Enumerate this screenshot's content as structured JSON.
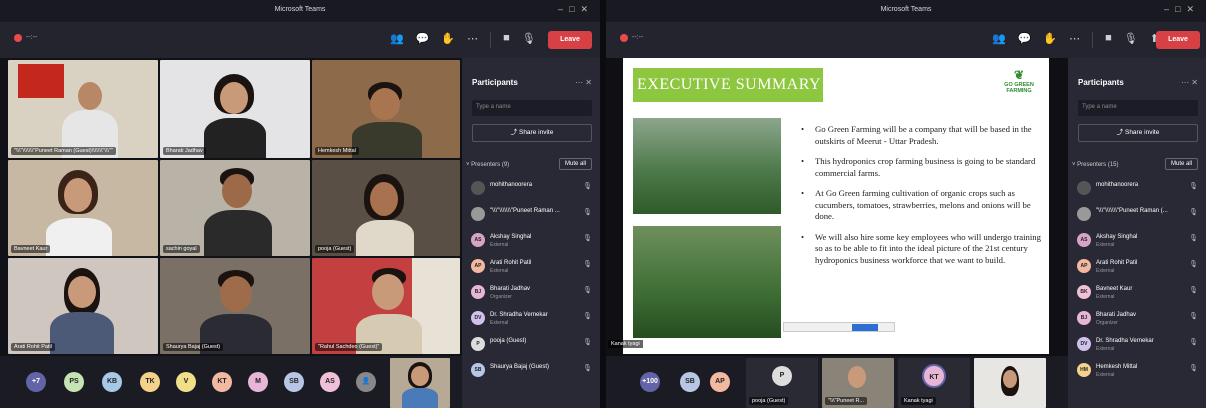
{
  "left": {
    "window_title": "Microsoft Teams",
    "rec_time": "--:--",
    "leave_label": "Leave",
    "tiles": [
      {
        "name": "\"\\\\\\\"\\\\\\\\\\\\\\\"Puneet Raman (Guest)\\\\\\\\\\\\\\\"\\\\\\\"\""
      },
      {
        "name": "Bharati Jadhav"
      },
      {
        "name": "Hemkesh Mittal"
      },
      {
        "name": "Bavneet Kaur"
      },
      {
        "name": "sachin goyal"
      },
      {
        "name": "pooja (Guest)"
      },
      {
        "name": "Arati Rohit Patil"
      },
      {
        "name": "Shaurya Bajaj (Guest)"
      },
      {
        "name": "\"Rahul Sachdeo (Guest)\""
      }
    ],
    "strip_avatars": [
      "+7",
      "PS",
      "KB",
      "TK",
      "V",
      "KT",
      "M",
      "SB",
      "AS"
    ],
    "panel": {
      "title": "Participants",
      "search_placeholder": "Type a name",
      "share_label": "Share invite",
      "section": "Presenters (9)",
      "mute_all": "Mute all",
      "people": [
        {
          "initials": "",
          "name": "mohithanoorera",
          "sub": ""
        },
        {
          "initials": "",
          "name": "\"\\\\\\\"\\\\\\\\\\\\\\\"Puneet Raman ...",
          "sub": ""
        },
        {
          "initials": "AS",
          "name": "Akshay Singhal",
          "sub": "External"
        },
        {
          "initials": "AP",
          "name": "Arati Rohit Patil",
          "sub": "External"
        },
        {
          "initials": "BJ",
          "name": "Bharati Jadhav",
          "sub": "Organizer"
        },
        {
          "initials": "DV",
          "name": "Dr. Shradha Vernekar",
          "sub": "External"
        },
        {
          "initials": "P",
          "name": "pooja (Guest)",
          "sub": ""
        },
        {
          "initials": "SB",
          "name": "Shaurya Bajaj (Guest)",
          "sub": ""
        }
      ]
    }
  },
  "right": {
    "window_title": "Microsoft Teams",
    "rec_time": "--:--",
    "leave_label": "Leave",
    "slide": {
      "title": "EXECUTIVE SUMMARY",
      "logo_line1": "GO GREEN",
      "logo_line2": "FARMING",
      "bullets": [
        "Go Green Farming will be a company that will be based in the outskirts of Meerut - Uttar Pradesh.",
        "This hydroponics crop farming business is going to be standard commercial farms.",
        "At Go Green farming cultivation of organic crops such as cucumbers, tomatoes, strawberries, melons and onions will be done.",
        "We will also hire some key employees who will undergo training so as to be able to fit into the ideal picture of the 21st century hydroponics business workforce that we want to build."
      ],
      "presenter": "Kanak tyagi"
    },
    "strip": {
      "count": "+100",
      "avatars": [
        "SB",
        "AP",
        "P",
        "KT"
      ],
      "labels": [
        "pooja (Guest)",
        "\"\\\\\\\"Puneet R...",
        "Kanak tyagi"
      ]
    },
    "panel": {
      "title": "Participants",
      "search_placeholder": "Type a name",
      "share_label": "Share invite",
      "section": "Presenters (15)",
      "mute_all": "Mute all",
      "people": [
        {
          "initials": "",
          "name": "mohithanoorera",
          "sub": ""
        },
        {
          "initials": "",
          "name": "\"\\\\\\\"\\\\\\\\\\\\\\\"Puneet Raman (...",
          "sub": ""
        },
        {
          "initials": "AS",
          "name": "Akshay Singhal",
          "sub": "External"
        },
        {
          "initials": "AP",
          "name": "Arati Rohit Patil",
          "sub": "External"
        },
        {
          "initials": "BK",
          "name": "Bavneet Kaur",
          "sub": "External"
        },
        {
          "initials": "BJ",
          "name": "Bharati Jadhav",
          "sub": "Organizer"
        },
        {
          "initials": "DV",
          "name": "Dr. Shradha Vernekar",
          "sub": "External"
        },
        {
          "initials": "HM",
          "name": "Hemkesh Mittal",
          "sub": "External"
        }
      ]
    }
  }
}
